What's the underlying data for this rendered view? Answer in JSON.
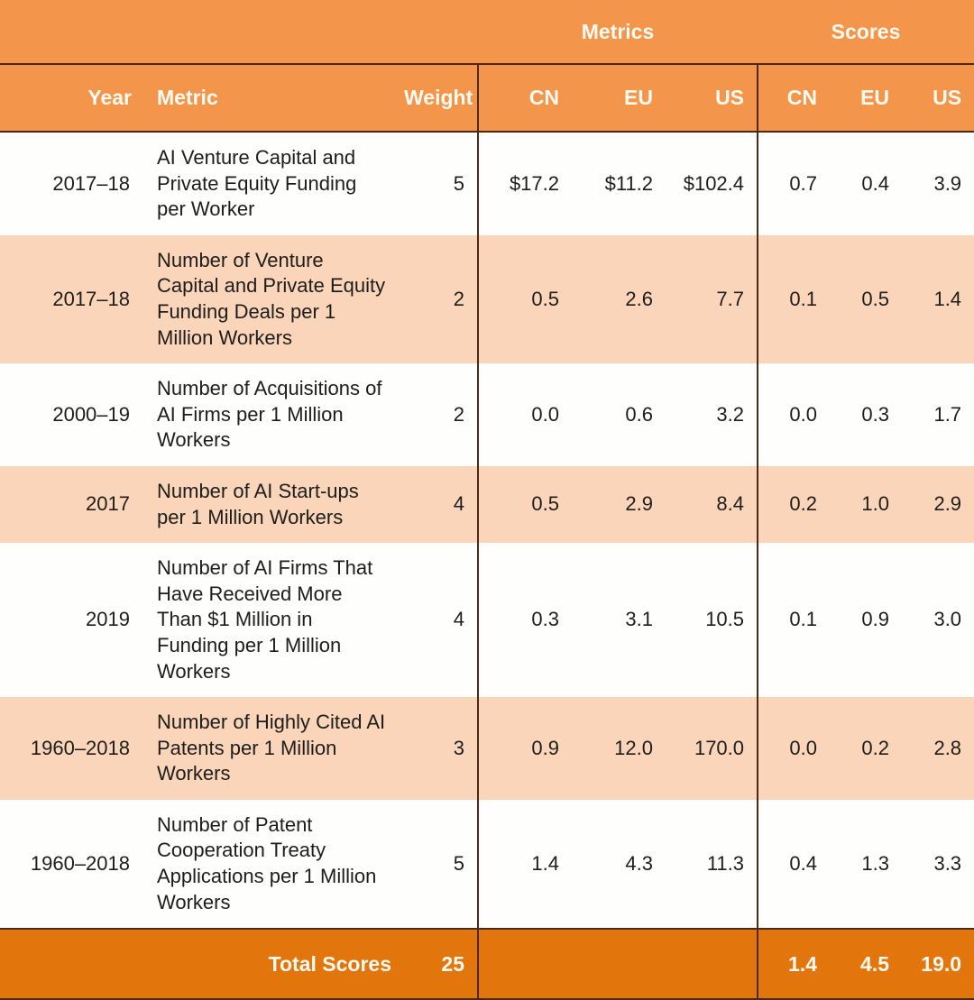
{
  "table": {
    "group_headers": {
      "spacer": "",
      "metrics": "Metrics",
      "scores": "Scores"
    },
    "columns": {
      "year": "Year",
      "metric": "Metric",
      "weight": "Weight",
      "metrics_cn": "CN",
      "metrics_eu": "EU",
      "metrics_us": "US",
      "scores_cn": "CN",
      "scores_eu": "EU",
      "scores_us": "US"
    },
    "rows": [
      {
        "year": "2017–18",
        "metric": "AI Venture Capital and Private Equity Funding per Worker",
        "weight": "5",
        "metrics_cn": "$17.2",
        "metrics_eu": "$11.2",
        "metrics_us": "$102.4",
        "scores_cn": "0.7",
        "scores_eu": "0.4",
        "scores_us": "3.9"
      },
      {
        "year": "2017–18",
        "metric": "Number of Venture Capital and Private Equity Funding Deals per 1 Million Workers",
        "weight": "2",
        "metrics_cn": "0.5",
        "metrics_eu": "2.6",
        "metrics_us": "7.7",
        "scores_cn": "0.1",
        "scores_eu": "0.5",
        "scores_us": "1.4"
      },
      {
        "year": "2000–19",
        "metric": "Number of Acquisitions of AI Firms per 1 Million Workers",
        "weight": "2",
        "metrics_cn": "0.0",
        "metrics_eu": "0.6",
        "metrics_us": "3.2",
        "scores_cn": "0.0",
        "scores_eu": "0.3",
        "scores_us": "1.7"
      },
      {
        "year": "2017",
        "metric": "Number of AI Start-ups per 1 Million Workers",
        "weight": "4",
        "metrics_cn": "0.5",
        "metrics_eu": "2.9",
        "metrics_us": "8.4",
        "scores_cn": "0.2",
        "scores_eu": "1.0",
        "scores_us": "2.9"
      },
      {
        "year": "2019",
        "metric": "Number of AI Firms That Have Received More Than $1 Million in Funding per 1 Million Workers",
        "weight": "4",
        "metrics_cn": "0.3",
        "metrics_eu": "3.1",
        "metrics_us": "10.5",
        "scores_cn": "0.1",
        "scores_eu": "0.9",
        "scores_us": "3.0"
      },
      {
        "year": "1960–2018",
        "metric": "Number of Highly Cited AI Patents per 1 Million Workers",
        "weight": "3",
        "metrics_cn": "0.9",
        "metrics_eu": "12.0",
        "metrics_us": "170.0",
        "scores_cn": "0.0",
        "scores_eu": "0.2",
        "scores_us": "2.8"
      },
      {
        "year": "1960–2018",
        "metric": "Number of Patent Cooperation Treaty Applications per 1 Million Workers",
        "weight": "5",
        "metrics_cn": "1.4",
        "metrics_eu": "4.3",
        "metrics_us": "11.3",
        "scores_cn": "0.4",
        "scores_eu": "1.3",
        "scores_us": "3.3"
      }
    ],
    "totals": {
      "label": "Total Scores",
      "weight": "25",
      "metrics_cn": "",
      "metrics_eu": "",
      "metrics_us": "",
      "scores_cn": "1.4",
      "scores_eu": "4.5",
      "scores_us": "19.0"
    }
  },
  "colors": {
    "header_orange": "#F3954A",
    "total_orange": "#E2750C",
    "row_peach": "#FBD5B9",
    "row_white": "#FEFEFC",
    "rule": "#4a2a14",
    "header_text": "#FFFBF2",
    "body_text": "#1d1d1b"
  }
}
